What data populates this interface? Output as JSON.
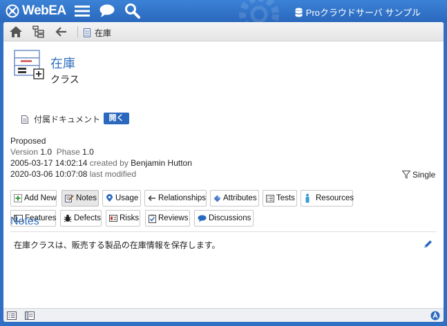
{
  "app": {
    "logo_text": "WebEA",
    "server_name": "Proクラウドサーバ サンプル"
  },
  "breadcrumb": {
    "label": "在庫"
  },
  "element": {
    "name": "在庫",
    "type": "クラス",
    "linked_document_label": "付属ドキュメント",
    "open_button": "開く",
    "status": "Proposed",
    "version_label": "Version",
    "version": "1.0",
    "phase_label": "Phase",
    "phase": "1.0",
    "created_date": "2005-03-17 14:02:14",
    "created_label": "created by",
    "author": "Benjamin Hutton",
    "modified_date": "2020-03-06 10:07:08",
    "modified_label": "last modified"
  },
  "tabs_row1": [
    {
      "label": "Add New",
      "icon": "add-icon"
    },
    {
      "label": "Notes",
      "icon": "notes-icon",
      "active": true
    },
    {
      "label": "Usage",
      "icon": "usage-icon"
    },
    {
      "label": "Relationships",
      "icon": "arrow-left-icon"
    },
    {
      "label": "Attributes",
      "icon": "attributes-icon"
    },
    {
      "label": "Tests",
      "icon": "tests-icon"
    },
    {
      "label": "Resources",
      "icon": "resources-icon"
    }
  ],
  "tabs_row2": [
    {
      "label": "Features",
      "icon": "features-icon"
    },
    {
      "label": "Defects",
      "icon": "bug-icon"
    },
    {
      "label": "Risks",
      "icon": "risks-icon"
    },
    {
      "label": "Reviews",
      "icon": "reviews-icon"
    },
    {
      "label": "Discussions",
      "icon": "chat-icon"
    }
  ],
  "single_label": "Single",
  "notes": {
    "title": "Notes",
    "text": "在庫クラスは、販売する製品の在庫情報を保存します。"
  },
  "colors": {
    "brand_blue": "#2f6fc4",
    "link_blue": "#2f6fbf",
    "button_blue": "#2b69bf"
  }
}
